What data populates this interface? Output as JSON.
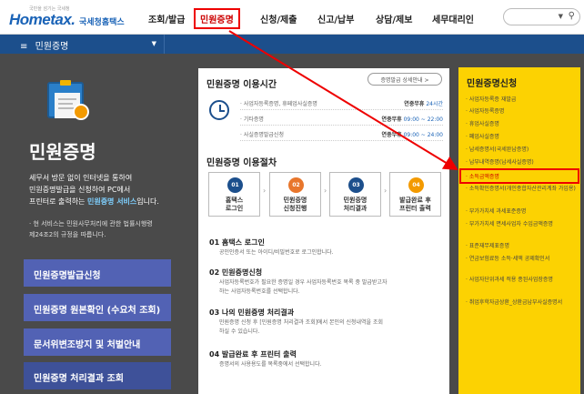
{
  "header": {
    "logo_small": "국민을 섬기는 국세청",
    "logo_main": "Hometax.",
    "logo_sub": "국세청홈택스",
    "nav": [
      {
        "label": "조회/발급"
      },
      {
        "label": "민원증명"
      },
      {
        "label": "신청/제출"
      },
      {
        "label": "신고/납부"
      },
      {
        "label": "상담/제보"
      },
      {
        "label": "세무대리인"
      }
    ],
    "search_dropdown_icon": "dropdown-arrow",
    "search_icon": "magnifier"
  },
  "menubar": {
    "icon": "hamburger",
    "label": "민원증명"
  },
  "hero": {
    "title": "민원증명",
    "desc1": "세무서 방문 없이 인터넷을 통하여",
    "desc2": "민원증명발급을 신청하여 PC에서",
    "desc3_pre": "프린터로 출력하는 ",
    "desc3_hl": "민원증명 서비스",
    "desc3_post": "입니다.",
    "note1": "· 현 서비스는 민원사무처리에 관한 법률시행령",
    "note2": "제24조2의 규정을 따릅니다.",
    "buttons": [
      {
        "label": "민원증명발급신청"
      },
      {
        "label": "민원증명 원본확인 (수요처 조회)"
      },
      {
        "label": "문서위변조방지 및 처벌안내"
      },
      {
        "label": "민원증명 처리결과 조회"
      }
    ]
  },
  "hours": {
    "title": "민원증명 이용시간",
    "help_button": "증명발급 상세안내 >",
    "rows": [
      {
        "label": "· 사업자등록증명, 휴페업사실증명",
        "lead": "연중무휴",
        "value": "24시간"
      },
      {
        "label": "· 기타증명",
        "lead": "연중무휴",
        "value": "09:00 ~ 22:00"
      },
      {
        "label": "· 사실증명발급신청",
        "lead": "연중무휴",
        "value": "09:00 ~ 24:00"
      }
    ]
  },
  "procedure": {
    "title": "민원증명 이용절차",
    "steps": [
      {
        "num": "01",
        "line1": "홈택스",
        "line2": "로그인",
        "color": "#1c4f8c"
      },
      {
        "num": "02",
        "line1": "민원증명",
        "line2": "신청진행",
        "color": "#e8762c"
      },
      {
        "num": "03",
        "line1": "민원증명",
        "line2": "처리결과",
        "color": "#1c4f8c"
      },
      {
        "num": "04",
        "line1": "발급완료 후",
        "line2": "프린터 출력",
        "color": "#f39a00"
      }
    ],
    "arrow": "›",
    "sections": [
      {
        "title": "01 홈택스 로그인",
        "lines": [
          "공인인증서 또는 아이디/비밀번호로 로그인합니다."
        ]
      },
      {
        "title": "02 민원증명신청",
        "lines": [
          "사업자등록번호가 필요한 증명일 경우 사업자등록번호 목록 중 발급받고자",
          "하는 사업자등록번호를 선택합니다."
        ]
      },
      {
        "title": "03 나의 민원증명 처리결과",
        "lines": [
          "민원증명 신청 후 [민원증명 처리결과 조회]에서 본인의 신청내역을 조회",
          "하실 수 있습니다."
        ]
      },
      {
        "title": "04 발급완료 후 프린터 출력",
        "lines": [
          "증명서의 사용용도를 목록중에서 선택합니다."
        ]
      }
    ]
  },
  "sidebar": {
    "title": "민원증명신청",
    "items": [
      {
        "label": "· 사업자등록증 재발급"
      },
      {
        "label": "· 사업자등록증명"
      },
      {
        "label": "· 휴업사실증명"
      },
      {
        "label": "· 폐업사실증명"
      },
      {
        "label": "· 납세증명서(국세완납증명)"
      },
      {
        "label": "· 납부내역증명(납세사실증명)"
      },
      {
        "label": "· 소득금액증명"
      },
      {
        "label": "· 소득확인증명서(개인종합자산관리계좌 가입용)"
      },
      {
        "label": "· 부가가치세 과세표준증명"
      },
      {
        "label": "· 부가가치세 면세사업자 수입금액증명"
      },
      {
        "label": "· 표준재무제표증명"
      },
      {
        "label": "· 연금보험료등 소득·세액 공제확인서"
      },
      {
        "label": "· 사업자단위과세 적용 종된사업장증명"
      },
      {
        "label": "· 취업후학자금상환_상환금납부사실증명서"
      }
    ]
  },
  "colors": {
    "brand": "#1a63b7",
    "menubar": "#1c4f8c",
    "sidebar": "#fcd202",
    "highlight": "#e00000"
  }
}
